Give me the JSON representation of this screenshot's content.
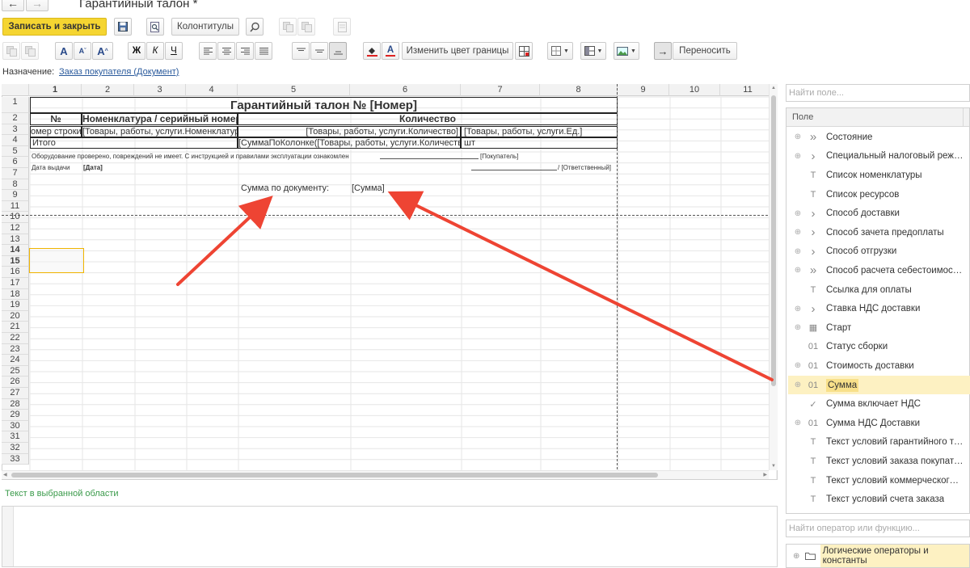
{
  "window": {
    "title": "Гарантийный талон *"
  },
  "toolbar1": {
    "save_close": "Записать и закрыть",
    "headers_footers": "Колонтитулы"
  },
  "toolbar2": {
    "bold": "Ж",
    "italic": "К",
    "underline": "Ч",
    "font_a": "A",
    "change_border_color": "Изменить цвет границы",
    "wrap": "Переносить"
  },
  "purpose": {
    "label": "Назначение:",
    "link": "Заказ покупателя (Документ)"
  },
  "sheet": {
    "columns": [
      "1",
      "2",
      "3",
      "4",
      "5",
      "6",
      "7",
      "8",
      "9",
      "10",
      "11"
    ],
    "rows": [
      "1",
      "2",
      "3",
      "4",
      "5",
      "6",
      "7",
      "8",
      "9",
      "11",
      "10",
      "12",
      "13",
      "14",
      "15",
      "16",
      "17",
      "18",
      "19",
      "20",
      "21",
      "22",
      "23",
      "24",
      "25",
      "26",
      "27",
      "28",
      "29",
      "30",
      "31",
      "32",
      "33"
    ],
    "title": "Гарантийный талон № [Номер]",
    "h_num": "№",
    "h_nomen": "Номенклатура / серийный номер",
    "h_qty": "Количество",
    "r3_num": "омер строки]",
    "r3_nomen": "[Товары, работы, услуги.Номенклатура",
    "r3_qty": "[Товары, работы, услуги.Количество]",
    "r3_unit": "[Товары, работы, услуги.Ед.]",
    "r4_total": "Итого",
    "r4_sum": "[СуммаПоКолонке([Товары, работы, услуги.Количество]",
    "r4_unit": "шт",
    "r5_text": "Оборудование проверено, повреждений не имеет. С инструкцией и правилами эксплуатации ознакомлен",
    "r5_buyer": "[Покупатель]",
    "r6_date_label": "Дата выдачи",
    "r6_date": "[Дата]",
    "r6_resp": "/ [Ответственный]",
    "r8_label": "Сумма по документу:",
    "r8_sum": "[Сумма]"
  },
  "text_area": {
    "label": "Текст в выбранной области"
  },
  "fields": {
    "search_placeholder": "Найти поле...",
    "col_header": "Поле",
    "items": [
      {
        "label": "Состояние",
        "icon": "double-chevron-icon"
      },
      {
        "label": "Специальный налоговый режим",
        "icon": "chevron-right-icon"
      },
      {
        "label": "Список номенклатуры",
        "icon": "text-type-icon"
      },
      {
        "label": "Список ресурсов",
        "icon": "text-type-icon"
      },
      {
        "label": "Способ доставки",
        "icon": "chevron-right-icon"
      },
      {
        "label": "Способ зачета предоплаты",
        "icon": "chevron-right-icon"
      },
      {
        "label": "Способ отгрузки",
        "icon": "chevron-right-icon"
      },
      {
        "label": "Способ расчета себестоимости ...",
        "icon": "double-chevron-icon"
      },
      {
        "label": "Ссылка для оплаты",
        "icon": "text-type-icon"
      },
      {
        "label": "Ставка НДС доставки",
        "icon": "chevron-right-icon"
      },
      {
        "label": "Старт",
        "icon": "calendar-icon"
      },
      {
        "label": "Статус сборки",
        "icon": "number-type-icon"
      },
      {
        "label": "Стоимость доставки",
        "icon": "number-type-icon"
      },
      {
        "label": "Сумма",
        "icon": "number-type-icon"
      },
      {
        "label": "Сумма включает НДС",
        "icon": "checkmark-icon"
      },
      {
        "label": "Сумма НДС Доставки",
        "icon": "number-type-icon"
      },
      {
        "label": "Текст условий гарантийного талона",
        "icon": "text-type-icon"
      },
      {
        "label": "Текст условий заказа покупателя",
        "icon": "text-type-icon"
      },
      {
        "label": "Текст условий коммерческого п...",
        "icon": "text-type-icon"
      },
      {
        "label": "Текст условий счета заказа",
        "icon": "text-type-icon"
      }
    ],
    "icon_text": {
      "text": "T",
      "num": "01",
      "chev": "›",
      "dchev": "»",
      "cal": "▦",
      "check": "✓"
    }
  },
  "operators": {
    "search_placeholder": "Найти оператор или функцию...",
    "first_item": "Логические операторы и константы"
  },
  "colors": {
    "accent_yellow": "#f5d531",
    "highlight": "#fdf1c2",
    "arrow": "#ee4433",
    "link": "#2a5a9c"
  }
}
